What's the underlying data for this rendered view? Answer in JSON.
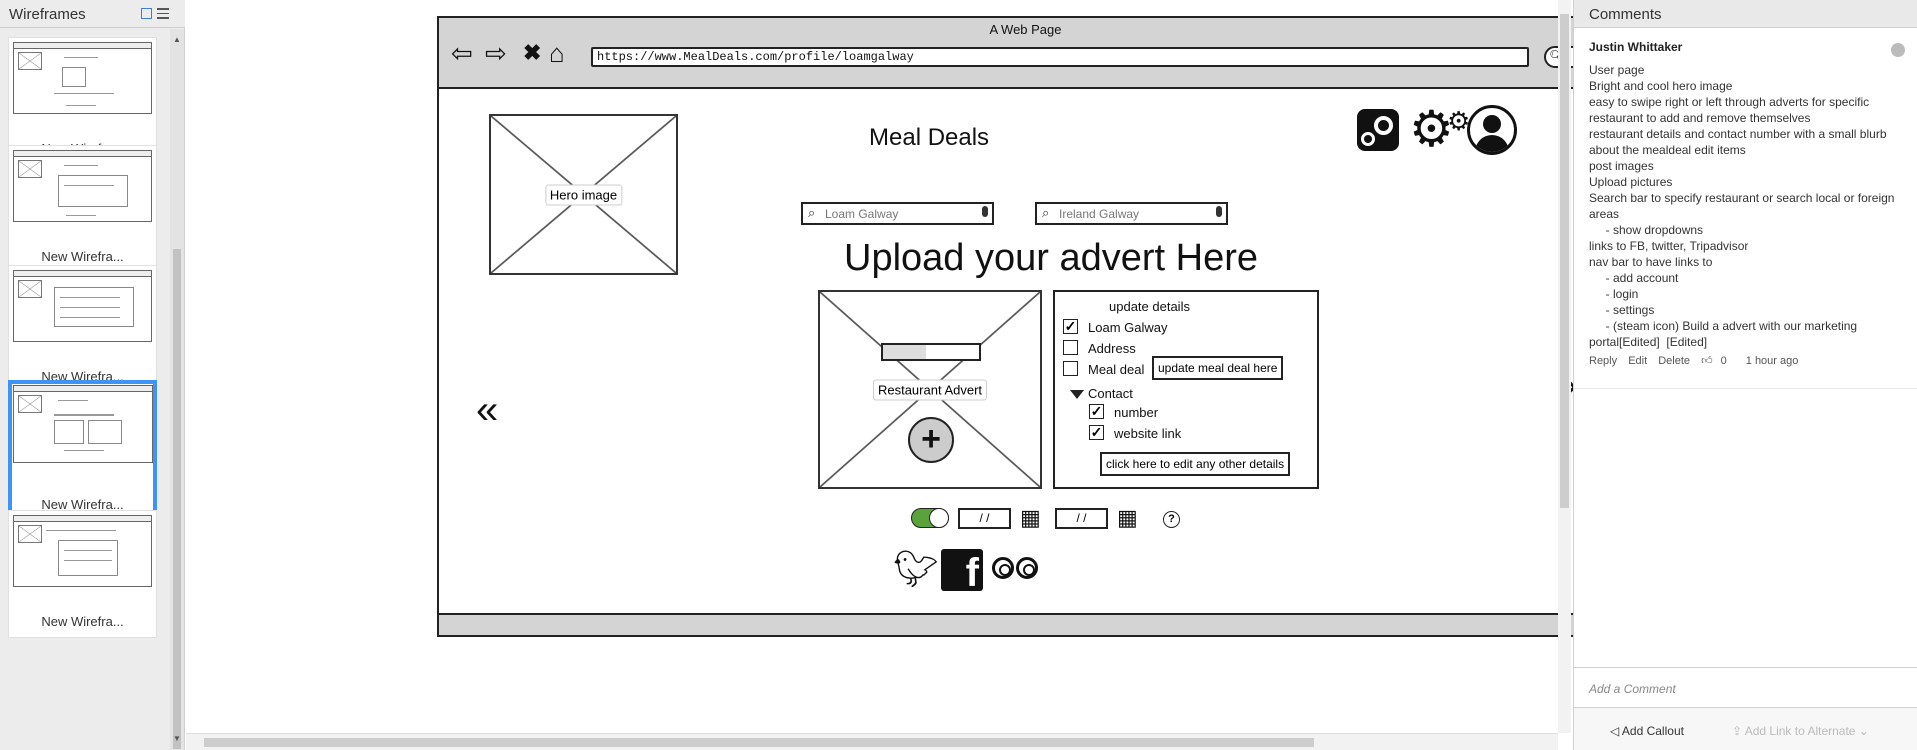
{
  "left_panel": {
    "title": "Wireframes",
    "thumbnails": [
      {
        "label": "New Wirefra..."
      },
      {
        "label": "New Wirefra..."
      },
      {
        "label": "New Wirefra..."
      },
      {
        "label": "New Wirefra..."
      },
      {
        "label": "New Wirefra..."
      }
    ],
    "selected_index": 3
  },
  "browser": {
    "title": "A Web Page",
    "url": "https://www.MealDeals.com/profile/loamgalway"
  },
  "page": {
    "hero_label": "Hero image",
    "site_title": "Meal Deals",
    "search1_placeholder": "Loam Galway",
    "search2_placeholder": "Ireland Galway",
    "upload_heading": "Upload your advert Here",
    "prev_arrow": "«",
    "next_arrow": "»",
    "advert_label": "Restaurant Advert",
    "advert_plus": "+",
    "progress_fraction": 0.45,
    "details": {
      "title": "update details",
      "items": [
        {
          "label": "Loam Galway",
          "checked": true
        },
        {
          "label": "Address",
          "checked": false
        },
        {
          "label": "Meal deal",
          "checked": false
        },
        {
          "label": "Contact",
          "expanded": true
        },
        {
          "label": "number",
          "checked": true
        },
        {
          "label": "website link",
          "checked": true
        }
      ],
      "meal_deal_button": "update meal deal here",
      "edit_other_button": "click here to edit any other details"
    },
    "toggle_on": true,
    "date1": "/ /",
    "date2": "/ /",
    "help": "?",
    "social": [
      "twitter-icon",
      "facebook-icon",
      "tripadvisor-icon"
    ]
  },
  "right_panel": {
    "title": "Comments",
    "comment": {
      "author": "Justin Whittaker",
      "lines": [
        "User page",
        "Bright and cool hero image",
        "easy to swipe right or left through adverts for specific restaurant to add and remove themselves",
        "restaurant details and contact number with a small blurb about the mealdeal edit items",
        "post images",
        "Upload pictures",
        "Search bar to specify restaurant or search local or foreign areas",
        "     - show dropdowns",
        "links to FB, twitter, Tripadvisor",
        "nav bar to have links to",
        "     - add account",
        "     - login",
        "     - settings",
        "     - (steam icon) Build a advert with our marketing portal[Edited]  [Edited]"
      ],
      "actions": {
        "reply": "Reply",
        "edit": "Edit",
        "delete": "Delete",
        "likes": "0",
        "time": "1 hour ago"
      }
    },
    "add_comment_placeholder": "Add a Comment",
    "add_callout": "Add Callout",
    "add_link": "Add Link to Alternate"
  },
  "colors": {
    "selected_thumb": "#3d94f6",
    "toggle_on": "#5aa33b",
    "browser_chrome": "#d4d4d4"
  }
}
